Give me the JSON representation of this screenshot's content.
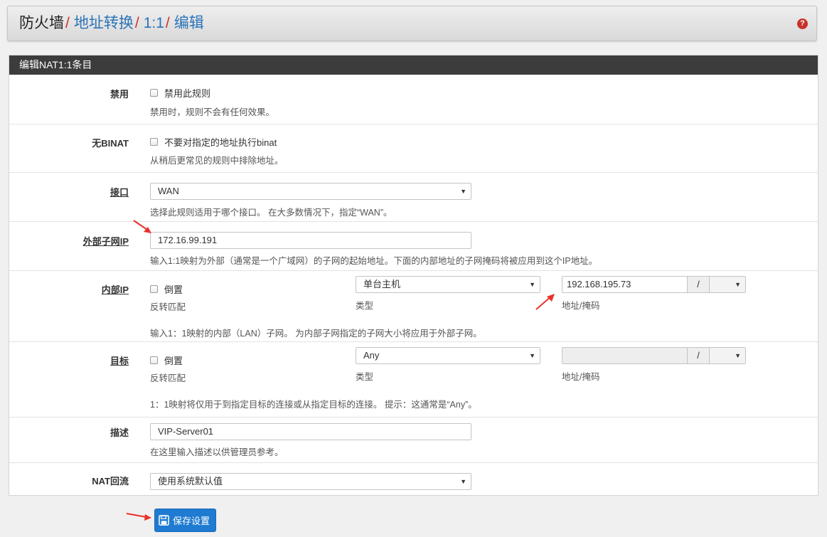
{
  "breadcrumb": {
    "items": [
      "防火墙",
      "地址转换",
      "1:1",
      "编辑"
    ],
    "separator": "/"
  },
  "help_icon": "question-circle-icon",
  "panel": {
    "title": "编辑NAT1:1条目"
  },
  "disable": {
    "label": "禁用",
    "checkbox_label": "禁用此规则",
    "help": "禁用时，规则不会有任何效果。"
  },
  "nobinat": {
    "label": "无BINAT",
    "checkbox_label": "不要对指定的地址执行binat",
    "help": "从稍后更常见的规则中排除地址。"
  },
  "interface": {
    "label": "接口",
    "value": "WAN",
    "help": "选择此规则适用于哪个接口。 在大多数情况下，指定“WAN”。"
  },
  "external": {
    "label": "外部子网IP",
    "value": "172.16.99.191",
    "help": "输入1:1映射为外部（通常是一个广域网）的子网的起始地址。下面的内部地址的子网掩码将被应用到这个IP地址。"
  },
  "internal": {
    "label": "内部IP",
    "invert_label": "倒置",
    "invert_help": "反转匹配",
    "type_value": "单台主机",
    "type_label": "类型",
    "address_value": "192.168.195.73",
    "mask_sep": "/",
    "mask_value": "",
    "address_label": "地址/掩码",
    "help": "输入1：1映射的内部（LAN）子网。 为内部子网指定的子网大小将应用于外部子网。"
  },
  "destination": {
    "label": "目标",
    "invert_label": "倒置",
    "invert_help": "反转匹配",
    "type_value": "Any",
    "type_label": "类型",
    "address_value": "",
    "mask_sep": "/",
    "mask_value": "",
    "address_label": "地址/掩码",
    "help": "1：1映射将仅用于到指定目标的连接或从指定目标的连接。 提示：这通常是“Any”。"
  },
  "description": {
    "label": "描述",
    "value": "VIP-Server01",
    "help": "在这里输入描述以供管理员参考。"
  },
  "natreflection": {
    "label": "NAT回流",
    "value": "使用系统默认值"
  },
  "save_button": {
    "label": "保存设置",
    "icon": "save-icon"
  },
  "colors": {
    "header_bg": "#e3e3e3",
    "panel_head_bg": "#3c3c3c",
    "link": "#2a73b8",
    "separator": "#c7332c",
    "button": "#1f7bd1",
    "annotation_arrow": "#e8312a"
  }
}
